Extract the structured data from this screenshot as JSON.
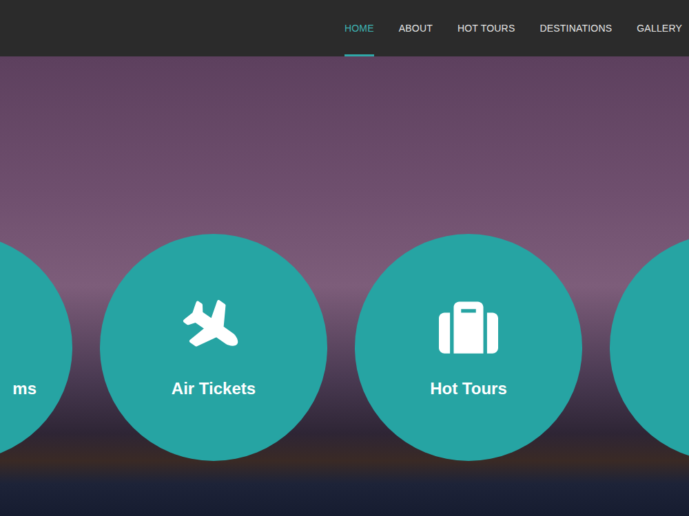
{
  "nav": {
    "items": [
      {
        "label": "HOME",
        "selected": true
      },
      {
        "label": "ABOUT",
        "selected": false
      },
      {
        "label": "HOT TOURS",
        "selected": false
      },
      {
        "label": "DESTINATIONS",
        "selected": false
      },
      {
        "label": "GALLERY",
        "selected": false
      }
    ]
  },
  "services": [
    {
      "label": "ms",
      "kind": "edgeleft"
    },
    {
      "label": "Air Tickets",
      "kind": "plane"
    },
    {
      "label": "Hot Tours",
      "kind": "suitcase"
    },
    {
      "label": "",
      "kind": "edgeright"
    }
  ]
}
